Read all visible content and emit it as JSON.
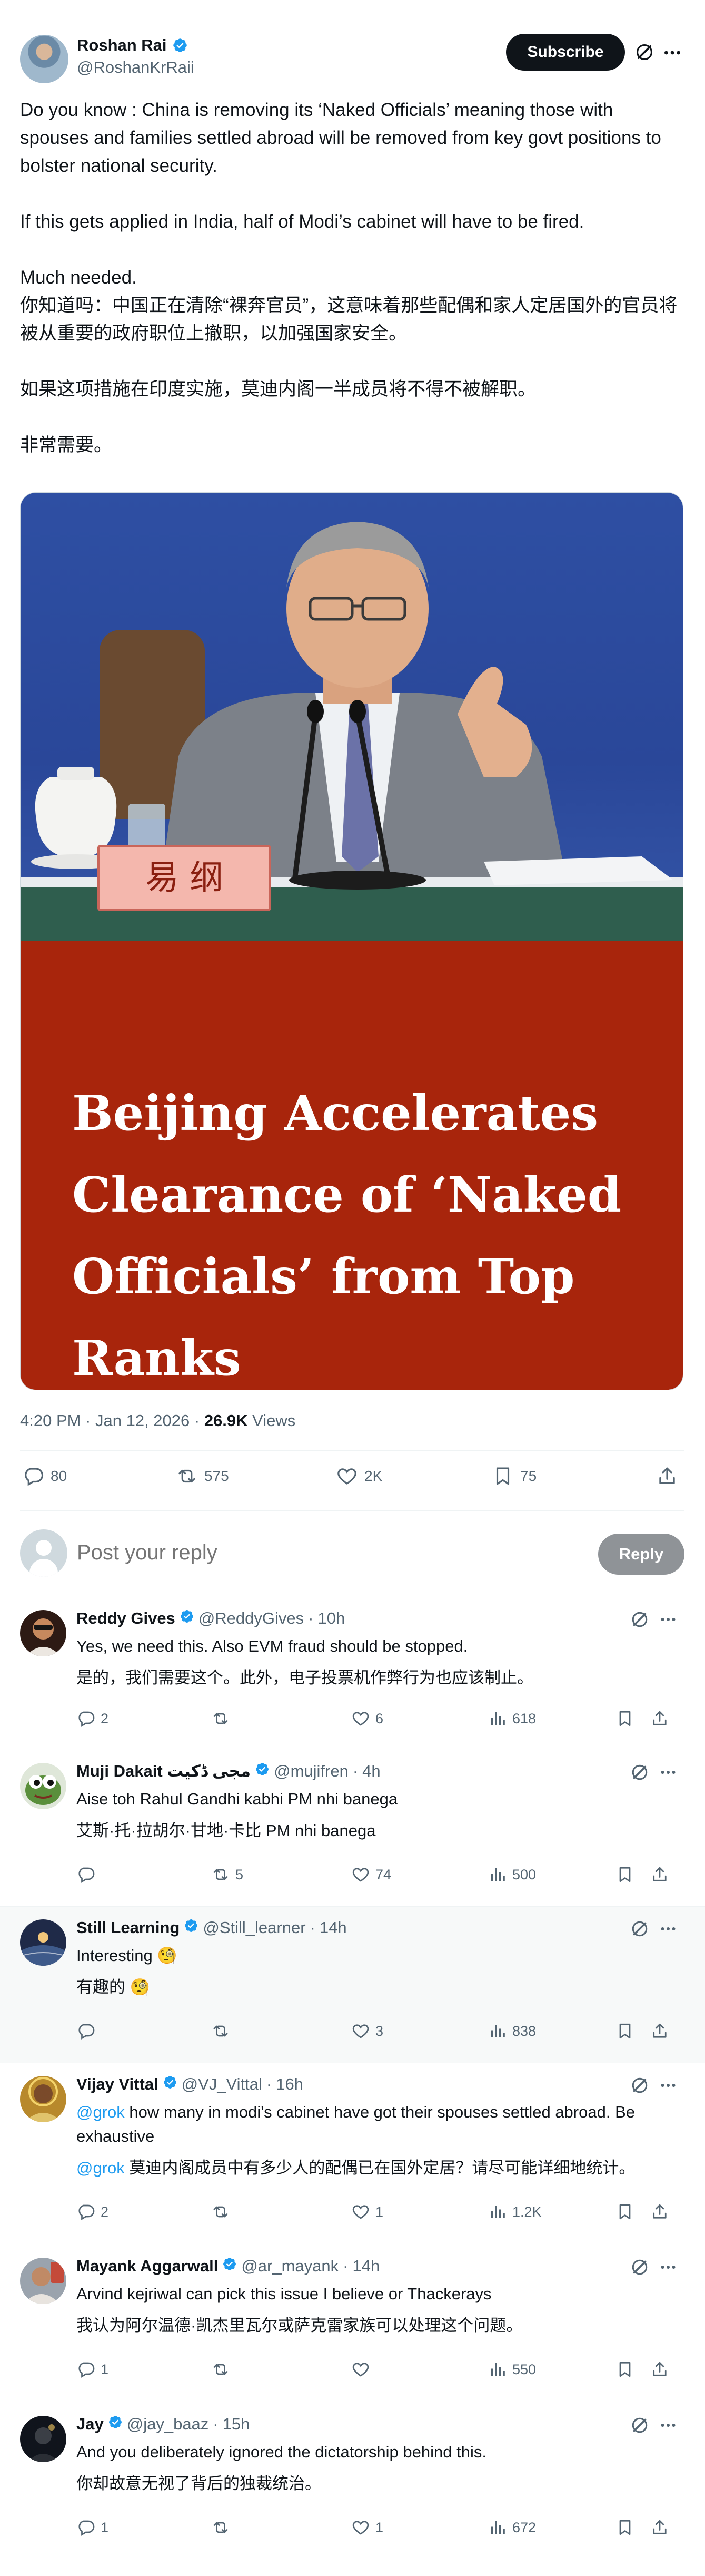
{
  "author": {
    "name": "Roshan Rai",
    "handle": "@RoshanKrRaii",
    "subscribe_label": "Subscribe"
  },
  "tweet": {
    "paragraphs_en": [
      "Do you know : China is removing its ‘Naked Officials’ meaning those with spouses and families settled abroad will be removed from key govt positions to bolster national security.",
      "If this gets applied in India, half of Modi’s cabinet will have to be fired.",
      "Much needed."
    ],
    "paragraphs_zh": [
      "你知道吗：中国正在清除“裸奔官员”，这意味着那些配偶和家人定居国外的官员将被从重要的政府职位上撤职，以加强国家安全。",
      "如果这项措施在印度实施，莫迪内阁一半成员将不得不被解职。",
      "非常需要。"
    ],
    "media": {
      "nameplate": "易  纲",
      "headline": "Beijing Accelerates Clearance of ‘Naked Officials’ from Top Ranks"
    },
    "timestamp": "4:20 PM · Jan 12, 2026 · ",
    "views_count": "26.9K",
    "views_label": " Views",
    "stats": {
      "replies": "80",
      "reposts": "575",
      "likes": "2K",
      "bookmarks": "75"
    }
  },
  "composer": {
    "placeholder": "Post your reply",
    "reply_label": "Reply"
  },
  "replies": [
    {
      "name": "Reddy Gives",
      "handle": "@ReddyGives",
      "dot": "·",
      "time": "10h",
      "lines": [
        "Yes, we need this. Also EVM fraud should be stopped.",
        "是的，我们需要这个。此外，电子投票机作弊行为也应该制止。"
      ],
      "replies": "2",
      "reposts": "",
      "likes": "6",
      "views": "618"
    },
    {
      "name": "Muji Dakait مجی ڈکیت",
      "handle": "@mujifren",
      "dot": "·",
      "time": "4h",
      "lines": [
        "Aise toh Rahul Gandhi kabhi PM nhi banega",
        "艾斯·托·拉胡尔·甘地·卡比 PM nhi banega"
      ],
      "replies": "",
      "reposts": "5",
      "likes": "74",
      "views": "500"
    },
    {
      "name": "Still Learning",
      "handle": "@Still_learner",
      "dot": "·",
      "time": "14h",
      "lines": [
        "Interesting 🧐",
        "有趣的 🧐"
      ],
      "replies": "",
      "reposts": "",
      "likes": "3",
      "views": "838"
    },
    {
      "name": "Vijay Vittal",
      "handle": "@VJ_Vittal",
      "dot": "·",
      "time": "16h",
      "mention": "@grok",
      "line1_rest": " how many in modi's cabinet have got their spouses settled abroad. Be exhaustive",
      "line2_rest": " 莫迪内阁成员中有多少人的配偶已在国外定居？请尽可能详细地统计。",
      "replies": "2",
      "reposts": "",
      "likes": "1",
      "views": "1.2K"
    },
    {
      "name": "Mayank Aggarwall",
      "handle": "@ar_mayank",
      "dot": "·",
      "time": "14h",
      "lines": [
        "Arvind kejriwal can pick this issue I believe or Thackerays",
        "我认为阿尔温德·凯杰里瓦尔或萨克雷家族可以处理这个问题。"
      ],
      "replies": "1",
      "reposts": "",
      "likes": "",
      "views": "550"
    },
    {
      "name": "Jay",
      "handle": "@jay_baaz",
      "dot": "·",
      "time": "15h",
      "lines": [
        "And you deliberately ignored the dictatorship behind this.",
        "你却故意无视了背后的独裁统治。"
      ],
      "replies": "1",
      "reposts": "",
      "likes": "1",
      "views": "672"
    }
  ],
  "colors": {
    "accent": "#1d9bf0",
    "headline_bg": "#a8250c",
    "photo_bg": "#2e4fa3",
    "text_primary": "#0f1419",
    "text_secondary": "#536471"
  },
  "icons": [
    "verified-badge-icon",
    "grok-icon",
    "more-icon",
    "reply-icon",
    "repost-icon",
    "like-icon",
    "bookmark-icon",
    "share-icon",
    "views-icon"
  ]
}
